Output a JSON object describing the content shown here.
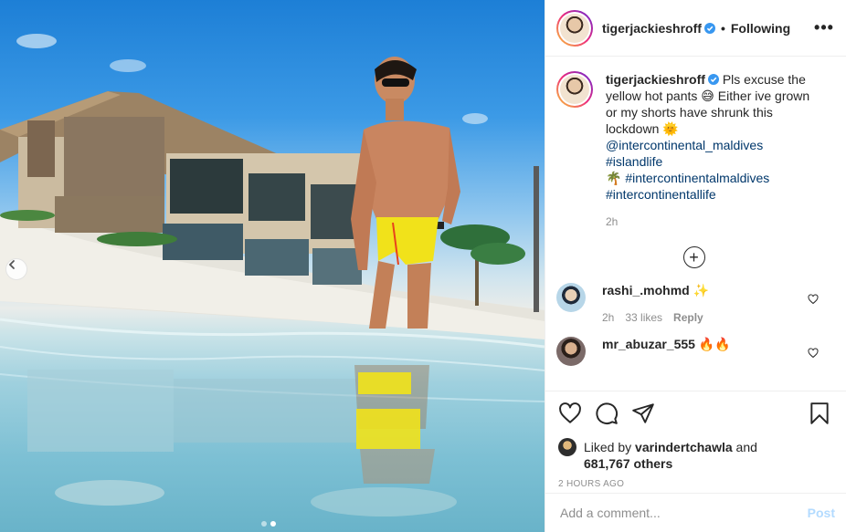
{
  "post_header": {
    "username": "tigerjackieshroff",
    "separator": "•",
    "follow_state": "Following",
    "more_label": "•••"
  },
  "caption": {
    "username": "tigerjackieshroff",
    "text_1": "Pls excuse the yellow hot pants ",
    "emoji_1": "😅",
    "text_2": "Either ive grown or my shorts have shrunk this lockdown ",
    "emoji_2": "🌞",
    "mention": "@intercontinental_maldives",
    "hashtag_1": "#islandlife",
    "emoji_3": "🌴",
    "hashtag_2": "#intercontinentalmaldives",
    "hashtag_3": "#intercontinentallife",
    "time": "2h"
  },
  "load_more_label": "+",
  "comments": [
    {
      "username": "rashi_.mohmd",
      "text": "✨",
      "time": "2h",
      "likes": "33 likes",
      "reply": "Reply"
    },
    {
      "username": "mr_abuzar_555",
      "text": "🔥🔥",
      "time": "",
      "likes": "",
      "reply": ""
    }
  ],
  "likes": {
    "prefix": "Liked by ",
    "user": "varindertchawla",
    "mid": " and",
    "count": "681,767 others",
    "count_suffix": ""
  },
  "posted_ago": "2 HOURS AGO",
  "add_comment": {
    "placeholder": "Add a comment...",
    "post_label": "Post"
  },
  "carousel": {
    "prev_label": "‹",
    "slides": 2,
    "active": 1
  },
  "colors": {
    "link": "#00376b",
    "muted": "#8e8e8e",
    "verified": "#3897f0",
    "post_btn": "#b3dbff"
  }
}
